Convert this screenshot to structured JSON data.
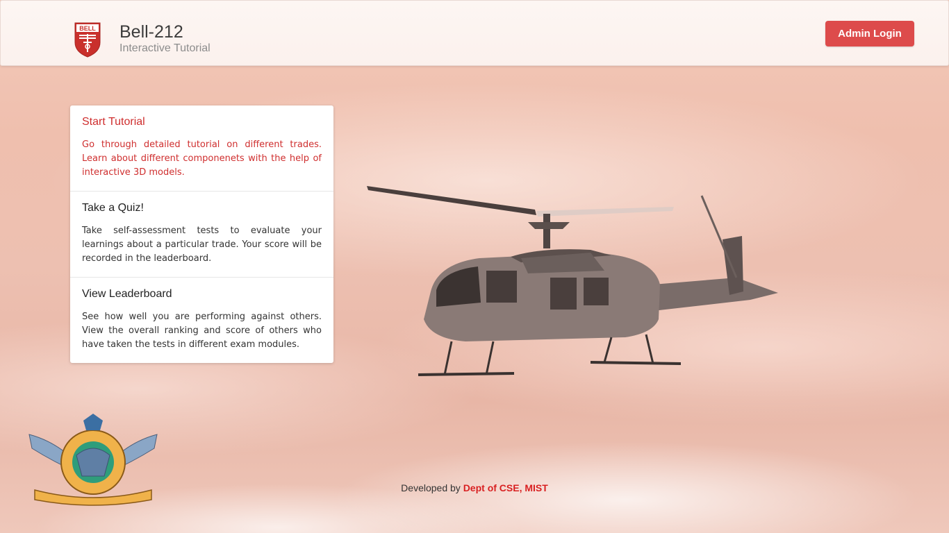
{
  "header": {
    "logo_text": "BELL",
    "title": "Bell-212",
    "subtitle": "Interactive Tutorial",
    "admin_login_label": "Admin Login"
  },
  "menu": {
    "items": [
      {
        "title": "Start Tutorial",
        "description": "Go through detailed tutorial on different trades. Learn about different componenets with the help of interactive 3D models.",
        "active": true
      },
      {
        "title": "Take a Quiz!",
        "description": "Take self-assessment tests to evaluate your learnings about a particular trade. Your score will be recorded in the leaderboard.",
        "active": false
      },
      {
        "title": "View Leaderboard",
        "description": "See how well you are performing against others. View the overall ranking and score of others who have taken the tests in different exam modules.",
        "active": false
      }
    ]
  },
  "footer": {
    "prefix": "Developed by",
    "link_text": "Dept of CSE, MIST"
  },
  "icons": {
    "header_logo": "bell-logo-icon",
    "hero_image": "helicopter-image",
    "emblem": "bangladesh-air-force-emblem"
  },
  "colors": {
    "accent_red": "#dd4b4b",
    "active_text": "#cf2e2e",
    "footer_link": "#d81e1e"
  }
}
